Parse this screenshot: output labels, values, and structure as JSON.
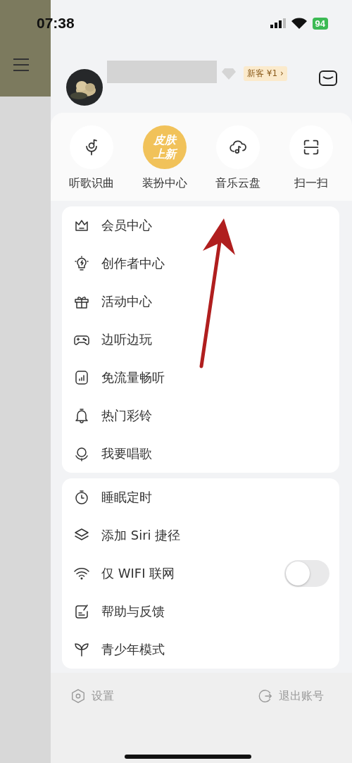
{
  "status_bar": {
    "time": "07:38",
    "battery": "94"
  },
  "profile": {
    "badge": "新客 ¥1 ›"
  },
  "quick_actions": [
    {
      "kind": "icon",
      "label": "听歌识曲"
    },
    {
      "kind": "badge",
      "badge_lines": [
        "皮肤",
        "上新"
      ],
      "label": "装扮中心"
    },
    {
      "kind": "icon",
      "label": "音乐云盘"
    },
    {
      "kind": "icon",
      "label": "扫一扫"
    }
  ],
  "menu": [
    {
      "label": "会员中心"
    },
    {
      "label": "创作者中心"
    },
    {
      "label": "活动中心"
    },
    {
      "label": "边听边玩"
    },
    {
      "label": "免流量畅听"
    },
    {
      "label": "热门彩铃"
    },
    {
      "label": "我要唱歌"
    }
  ],
  "settings_menu": [
    {
      "kind": "link",
      "label": "睡眠定时"
    },
    {
      "kind": "link",
      "label": "添加 Siri 捷径"
    },
    {
      "kind": "toggle",
      "label": "仅 WIFI 联网",
      "on": false
    },
    {
      "kind": "link",
      "label": "帮助与反馈"
    },
    {
      "kind": "link",
      "label": "青少年模式"
    }
  ],
  "footer": [
    {
      "label": "设置"
    },
    {
      "label": "退出账号"
    }
  ]
}
